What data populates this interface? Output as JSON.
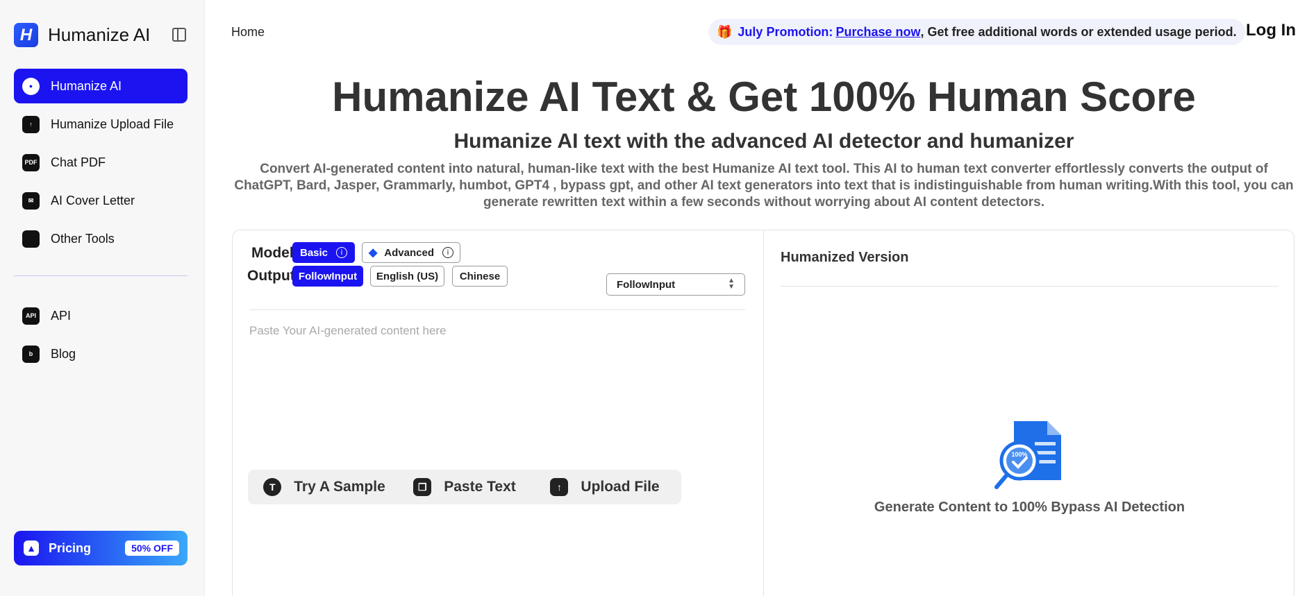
{
  "sidebar": {
    "brand": "Humanize AI",
    "items": [
      {
        "label": "Humanize AI",
        "icon": "brain-icon"
      },
      {
        "label": "Humanize Upload File",
        "icon": "file-upload-icon"
      },
      {
        "label": "Chat PDF",
        "icon": "pdf-icon",
        "icon_text": "PDF"
      },
      {
        "label": "AI Cover Letter",
        "icon": "envelope-icon"
      },
      {
        "label": "Other Tools",
        "icon": "grid-icon"
      }
    ],
    "secondary_items": [
      {
        "label": "API",
        "icon": "api-icon",
        "icon_text": "API"
      },
      {
        "label": "Blog",
        "icon": "blog-icon"
      }
    ],
    "pricing": {
      "label": "Pricing",
      "badge": "50% OFF"
    }
  },
  "header": {
    "home": "Home",
    "promo": {
      "title": "July Promotion:",
      "link": "Purchase now",
      "text": ", Get free additional words or extended usage period."
    },
    "login": "Log In"
  },
  "hero": {
    "title": "Humanize AI Text & Get 100% Human Score",
    "subtitle": "Humanize AI text with the advanced AI detector and humanizer",
    "description": "Convert AI-generated content into natural, human-like text with the best Humanize AI text tool. This AI to human text converter effortlessly converts the output of ChatGPT, Bard, Jasper, Grammarly, humbot, GPT4 , bypass gpt, and other AI text generators into text that is indistinguishable from human writing.With this tool, you can generate rewritten text within a few seconds without worrying about AI content detectors."
  },
  "tool": {
    "model_label": "Model",
    "models": [
      "Basic",
      "Advanced"
    ],
    "selected_model": "Basic",
    "output_label": "Output",
    "outputs": [
      "FollowInput",
      "English (US)",
      "Chinese"
    ],
    "selected_output": "FollowInput",
    "output_select_value": "FollowInput",
    "input_placeholder": "Paste Your AI-generated content here",
    "actions": [
      "Try A Sample",
      "Paste Text",
      "Upload File"
    ],
    "result_title": "Humanized Version",
    "result_caption": "Generate Content to 100% Bypass AI Detection",
    "illustration_badge": "100%"
  },
  "colors": {
    "accent": "#1b14f0",
    "promo_bg": "#f0f2fb"
  }
}
